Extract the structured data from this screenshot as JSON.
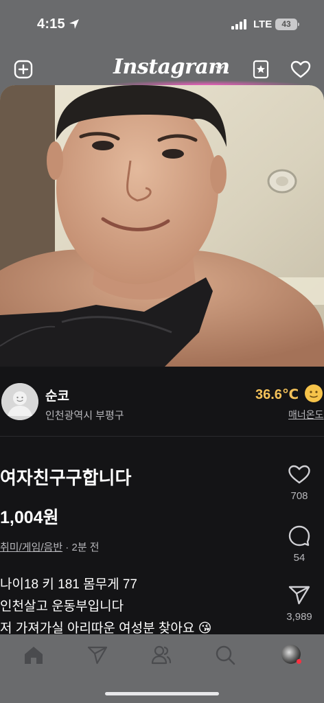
{
  "status_bar": {
    "time": "4:15",
    "network": "LTE",
    "battery": "43"
  },
  "header": {
    "logo_text": "Instagram",
    "icons": [
      "plus-square-icon",
      "chevron-down-icon",
      "starred-news-icon",
      "heart-icon"
    ]
  },
  "post": {
    "seller": {
      "name": "순코",
      "location": "인천광역시 부평구",
      "temperature": "36.6℃",
      "manner_label": "매너온도"
    },
    "title": "여자친구구합니다",
    "price": "1,004원",
    "category": "취미/게임/음반",
    "time_ago": " · 2분 전",
    "description": [
      "나이18 키 181 몸무게 77",
      "인천살고 운동부입니다",
      "저 가져가실 아리따운 여성분 찾아요 😘"
    ],
    "actions": {
      "likes": "708",
      "comments": "54",
      "shares": "3,989"
    }
  },
  "bottom_nav": {
    "items": [
      "home-icon",
      "direct-icon",
      "friends-icon",
      "search-icon",
      "profile-avatar"
    ]
  },
  "colors": {
    "card_bg": "#141416",
    "temperature": "#f4c25a",
    "secondary_text": "#b8b8bc",
    "chrome": "#6a6b6d"
  }
}
